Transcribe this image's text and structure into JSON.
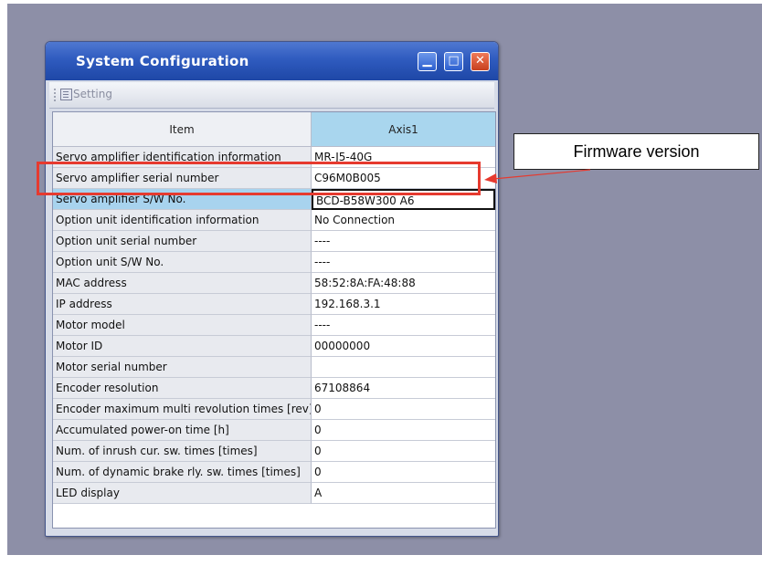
{
  "window": {
    "title": "System Configuration",
    "buttons": {
      "minimize": "▁",
      "maximize": "□",
      "close": "✕"
    }
  },
  "toolbar": {
    "setting_label": "Setting"
  },
  "table": {
    "headers": {
      "item": "Item",
      "axis": "Axis1"
    },
    "rows": [
      {
        "item": "Servo amplifier identification information",
        "value": "MR-J5-40G"
      },
      {
        "item": "Servo amplifier serial number",
        "value": "C96M0B005"
      },
      {
        "item": "Servo amplifier S/W No.",
        "value": "BCD-B58W300 A6"
      },
      {
        "item": "Option unit identification information",
        "value": "No Connection"
      },
      {
        "item": "Option unit serial number",
        "value": "----"
      },
      {
        "item": "Option unit S/W No.",
        "value": "----"
      },
      {
        "item": "MAC address",
        "value": "58:52:8A:FA:48:88"
      },
      {
        "item": "IP address",
        "value": "192.168.3.1"
      },
      {
        "item": "Motor model",
        "value": "----"
      },
      {
        "item": "Motor ID",
        "value": "00000000"
      },
      {
        "item": "Motor serial number",
        "value": ""
      },
      {
        "item": "Encoder resolution",
        "value": "67108864"
      },
      {
        "item": "Encoder maximum multi revolution times [rev]",
        "value": "0"
      },
      {
        "item": "Accumulated power-on time [h]",
        "value": "0"
      },
      {
        "item": "Num. of inrush cur. sw. times [times]",
        "value": "0"
      },
      {
        "item": "Num. of dynamic brake rly. sw. times [times]",
        "value": "0"
      },
      {
        "item": "LED display",
        "value": "A"
      }
    ]
  },
  "annotation": {
    "callout_text": "Firmware version",
    "highlight_color": "#e63a2f"
  }
}
